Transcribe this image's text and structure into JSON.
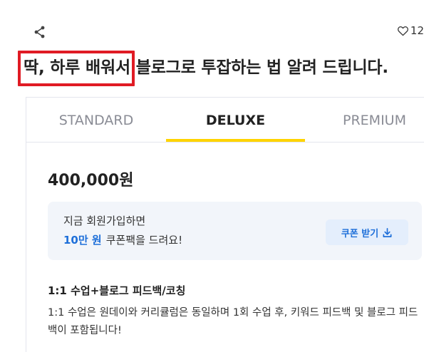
{
  "header": {
    "like_count": "12"
  },
  "title": {
    "highlighted": "딱, 하루 배워서",
    "rest": " 블로그로 투잡하는 법 알려 드립니다."
  },
  "tabs": [
    {
      "label": "STANDARD",
      "active": false
    },
    {
      "label": "DELUXE",
      "active": true
    },
    {
      "label": "PREMIUM",
      "active": false
    }
  ],
  "package": {
    "price": "400,000원",
    "promo": {
      "line1": "지금 회원가입하면",
      "amount": "10만 원",
      "line2_rest": "쿠폰팩을 드려요!",
      "button_label": "쿠폰 받기"
    },
    "title": "1:1 수업+블로그 피드백/코칭",
    "description": "1:1 수업은 원데이와 커리큘럼은 동일하며 1회 수업 후, 키워드 피드백 및 블로그 피드백이 포함됩니다!"
  },
  "colors": {
    "accent_yellow": "#ffd400",
    "link_blue": "#1e6fd9",
    "highlight_red": "#e01b24"
  }
}
